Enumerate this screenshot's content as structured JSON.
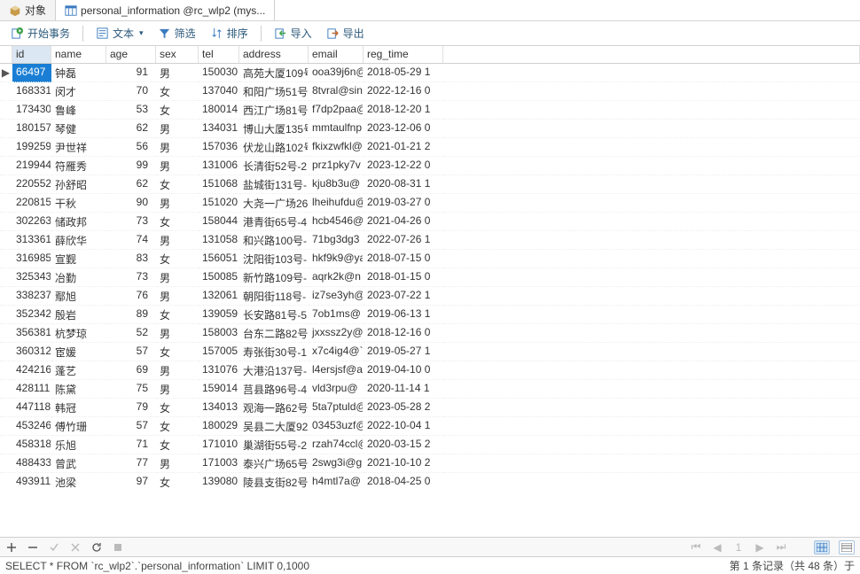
{
  "tabs": {
    "objects": "对象",
    "table": "personal_information @rc_wlp2 (mys..."
  },
  "toolbar": {
    "begin_tx": "开始事务",
    "text": "文本",
    "filter": "筛选",
    "sort": "排序",
    "import": "导入",
    "export": "导出"
  },
  "columns": {
    "id": "id",
    "name": "name",
    "age": "age",
    "sex": "sex",
    "tel": "tel",
    "address": "address",
    "email": "email",
    "reg_time": "reg_time"
  },
  "rows": [
    {
      "id": "66497",
      "name": "钟磊",
      "age": 91,
      "sex": "男",
      "tel": "150030",
      "address": "高苑大厦109号",
      "email": "ooa39j6n@",
      "reg": "2018-05-29 1"
    },
    {
      "id": "168331",
      "name": "闵才",
      "age": 70,
      "sex": "女",
      "tel": "137040",
      "address": "和阳广场51号",
      "email": "8tvral@sin",
      "reg": "2022-12-16 0"
    },
    {
      "id": "173430",
      "name": "鲁峰",
      "age": 53,
      "sex": "女",
      "tel": "180014",
      "address": "西江广场81号",
      "email": "f7dp2paa@",
      "reg": "2018-12-20 1"
    },
    {
      "id": "180157",
      "name": "琴健",
      "age": 62,
      "sex": "男",
      "tel": "134031",
      "address": "博山大厦135号",
      "email": "mmtaulfnp",
      "reg": "2023-12-06 0"
    },
    {
      "id": "199259",
      "name": "尹世祥",
      "age": 56,
      "sex": "男",
      "tel": "157036",
      "address": "伏龙山路102号",
      "email": "fkixzwfkl@",
      "reg": "2021-01-21 2"
    },
    {
      "id": "219944",
      "name": "符雁秀",
      "age": 99,
      "sex": "男",
      "tel": "131006",
      "address": "长清街52号-2",
      "email": "prz1pky7v",
      "reg": "2023-12-22 0"
    },
    {
      "id": "220552",
      "name": "孙舒昭",
      "age": 62,
      "sex": "女",
      "tel": "151068",
      "address": "盐城街131号-",
      "email": "kju8b3u@",
      "reg": "2020-08-31 1"
    },
    {
      "id": "220815",
      "name": "干秋",
      "age": 90,
      "sex": "男",
      "tel": "151020",
      "address": "大尧一广场26",
      "email": "lheihufdu@",
      "reg": "2019-03-27 0"
    },
    {
      "id": "302263",
      "name": "储政邦",
      "age": 73,
      "sex": "女",
      "tel": "158044",
      "address": "港青街65号-4",
      "email": "hcb4546@",
      "reg": "2021-04-26 0"
    },
    {
      "id": "313361",
      "name": "薛欣华",
      "age": 74,
      "sex": "男",
      "tel": "131058",
      "address": "和兴路100号-",
      "email": "71bg3dg3",
      "reg": "2022-07-26 1"
    },
    {
      "id": "316985",
      "name": "宣觐",
      "age": 83,
      "sex": "女",
      "tel": "156051",
      "address": "沈阳街103号-",
      "email": "hkf9k9@ya",
      "reg": "2018-07-15 0"
    },
    {
      "id": "325343",
      "name": "冶勤",
      "age": 73,
      "sex": "男",
      "tel": "150085",
      "address": "新竹路109号-",
      "email": "aqrk2k@n",
      "reg": "2018-01-15 0"
    },
    {
      "id": "338237",
      "name": "鄢旭",
      "age": 76,
      "sex": "男",
      "tel": "132061",
      "address": "朝阳街118号-",
      "email": "iz7se3yh@",
      "reg": "2023-07-22 1"
    },
    {
      "id": "352342",
      "name": "殷岩",
      "age": 89,
      "sex": "女",
      "tel": "139059",
      "address": "长安路81号-5",
      "email": "7ob1ms@",
      "reg": "2019-06-13 1"
    },
    {
      "id": "356381",
      "name": "杭梦琼",
      "age": 52,
      "sex": "男",
      "tel": "158003",
      "address": "台东二路82号",
      "email": "jxxssz2y@",
      "reg": "2018-12-16 0"
    },
    {
      "id": "360312",
      "name": "宦媛",
      "age": 57,
      "sex": "女",
      "tel": "157005",
      "address": "寿张街30号-1",
      "email": "x7c4ig4@`",
      "reg": "2019-05-27 1"
    },
    {
      "id": "424216",
      "name": "蓬艺",
      "age": 69,
      "sex": "男",
      "tel": "131076",
      "address": "大港沿137号-",
      "email": "l4ersjsf@a",
      "reg": "2019-04-10 0"
    },
    {
      "id": "428111",
      "name": "陈黛",
      "age": 75,
      "sex": "男",
      "tel": "159014",
      "address": "莒县路96号-4",
      "email": "vld3rpu@",
      "reg": "2020-11-14 1"
    },
    {
      "id": "447118",
      "name": "韩冠",
      "age": 79,
      "sex": "女",
      "tel": "134013",
      "address": "观海一路62号",
      "email": "5ta7ptuld@",
      "reg": "2023-05-28 2"
    },
    {
      "id": "453246",
      "name": "傅竹珊",
      "age": 57,
      "sex": "女",
      "tel": "180029",
      "address": "吴县二大厦92",
      "email": "03453uzf@",
      "reg": "2022-10-04 1"
    },
    {
      "id": "458318",
      "name": "乐旭",
      "age": 71,
      "sex": "女",
      "tel": "171010",
      "address": "巢湖街55号-2",
      "email": "rzah74ccl@",
      "reg": "2020-03-15 2"
    },
    {
      "id": "488433",
      "name": "曾武",
      "age": 77,
      "sex": "男",
      "tel": "171003",
      "address": "泰兴广场65号",
      "email": "2swg3i@g",
      "reg": "2021-10-10 2"
    },
    {
      "id": "493911",
      "name": "池梁",
      "age": 97,
      "sex": "女",
      "tel": "139080",
      "address": "陵县支街82号",
      "email": "h4mtl7a@",
      "reg": "2018-04-25 0"
    }
  ],
  "selected_row": 0,
  "query": "SELECT * FROM `rc_wlp2`.`personal_information` LIMIT 0,1000",
  "status_right": "第 1 条记录（共 48 条）于"
}
